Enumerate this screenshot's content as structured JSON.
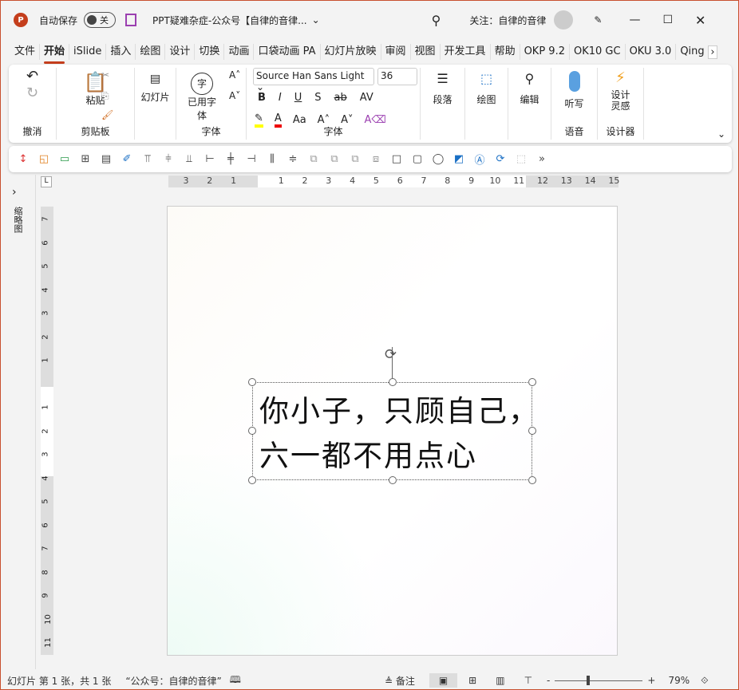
{
  "titlebar": {
    "autosave_label": "自动保存",
    "autosave_state": "关",
    "doc_title": "PPT疑难杂症-公众号【自律的音律...",
    "follow": "关注：自律的音律",
    "app_icon": "P"
  },
  "tabs": [
    "文件",
    "开始",
    "iSlide",
    "插入",
    "绘图",
    "设计",
    "切换",
    "动画",
    "口袋动画 PA",
    "幻灯片放映",
    "审阅",
    "视图",
    "开发工具",
    "帮助",
    "OKP 9.2",
    "OK10 GC",
    "OKU 3.0",
    "Qing"
  ],
  "active_tab": "开始",
  "ribbon": {
    "undo_group": "撤消",
    "paste": "粘贴",
    "clipboard_group": "剪贴板",
    "slides": "幻灯片",
    "used_fonts": "已用字体",
    "used_fonts_char": "字",
    "font_group1": "字体",
    "font_name": "Source Han Sans Light",
    "font_size": "36",
    "font_group2": "字体",
    "bold": "B",
    "italic": "I",
    "underline": "U",
    "shadow": "S",
    "strike": "ab",
    "spacing": "AV",
    "case": "Aa",
    "paragraph": "段落",
    "drawing": "绘图",
    "editing": "编辑",
    "dictate": "听写",
    "voice_group": "语音",
    "designer": "设计灵感",
    "designer_group": "设计器",
    "highlight_color": "#ffff00",
    "font_color": "#e00000"
  },
  "ruler": {
    "labels": [
      "3",
      "2",
      "1",
      "",
      "1",
      "2",
      "3",
      "4",
      "5",
      "6",
      "7",
      "8",
      "9",
      "10",
      "11",
      "12",
      "13",
      "14",
      "15"
    ]
  },
  "vruler": {
    "labels": [
      "7",
      "6",
      "5",
      "4",
      "3",
      "2",
      "1",
      "",
      "1",
      "2",
      "3",
      "4",
      "5",
      "6",
      "7",
      "8",
      "9",
      "10",
      "11"
    ]
  },
  "leftpane": {
    "label": "缩略图"
  },
  "slide": {
    "line1": "你小子，只顾自己，",
    "line2": "六一都不用点心"
  },
  "status": {
    "slide_info": "幻灯片 第 1 张，共 1 张",
    "theme": "“公众号：自律的音律”",
    "notes": "备注",
    "zoom": "79%"
  }
}
